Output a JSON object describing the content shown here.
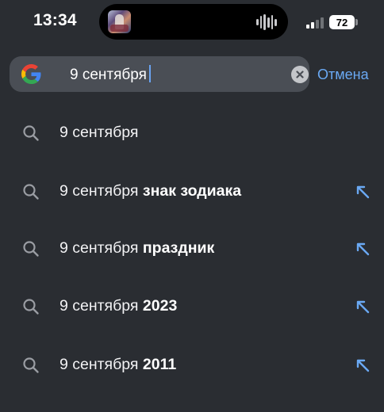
{
  "status_bar": {
    "time": "13:34",
    "battery_level": "72",
    "signal_bars_active": 2,
    "signal_bars_total": 4
  },
  "search": {
    "query": "9 сентября",
    "cancel_label": "Отмена",
    "engine_icon": "google-logo-icon",
    "clear_icon": "clear-x-icon"
  },
  "suggestions": [
    {
      "text": "9 сентября",
      "completion": "",
      "has_fill_arrow": false
    },
    {
      "text": "9 сентября",
      "completion": "знак зодиака",
      "has_fill_arrow": true
    },
    {
      "text": "9 сентября",
      "completion": "праздник",
      "has_fill_arrow": true
    },
    {
      "text": "9 сентября",
      "completion": "2023",
      "has_fill_arrow": true
    },
    {
      "text": "9 сентября",
      "completion": "2011",
      "has_fill_arrow": true
    }
  ],
  "colors": {
    "background": "#2a2d32",
    "search_field": "#4a4e55",
    "accent": "#6aa9f4"
  }
}
